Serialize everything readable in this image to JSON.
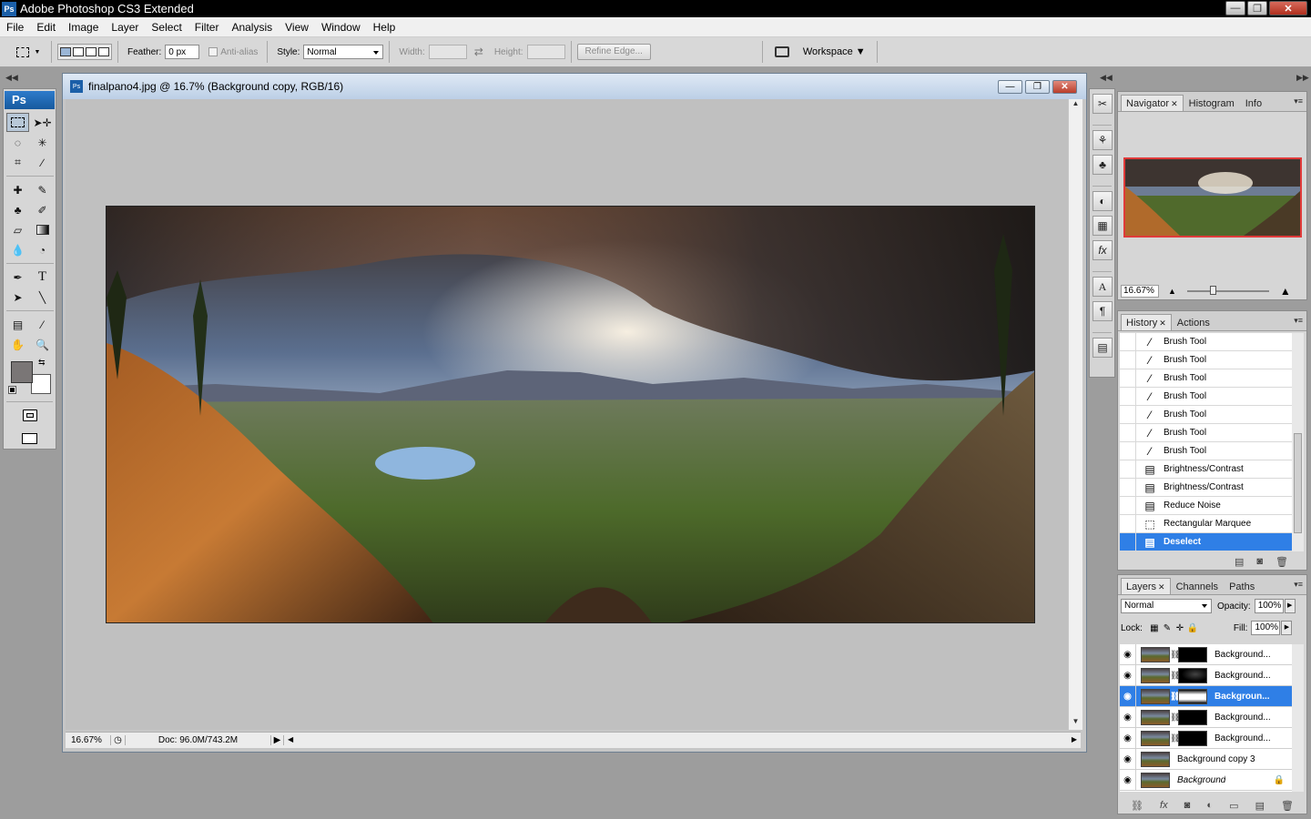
{
  "app": {
    "title": "Adobe Photoshop CS3 Extended",
    "logo": "Ps",
    "window_buttons": [
      "—",
      "❐",
      "✕"
    ]
  },
  "menu": [
    "File",
    "Edit",
    "Image",
    "Layer",
    "Select",
    "Filter",
    "Analysis",
    "View",
    "Window",
    "Help"
  ],
  "options": {
    "feather_label": "Feather:",
    "feather_value": "0 px",
    "antialias_label": "Anti-alias",
    "style_label": "Style:",
    "style_value": "Normal",
    "width_label": "Width:",
    "height_label": "Height:",
    "refine_edge": "Refine Edge...",
    "workspace": "Workspace ▼"
  },
  "toolbox": {
    "logo": "Ps"
  },
  "document": {
    "title": "finalpano4.jpg @ 16.7% (Background copy, RGB/16)",
    "status_zoom": "16.67%",
    "status_doc": "Doc: 96.0M/743.2M"
  },
  "navigator": {
    "tabs": [
      "Navigator",
      "Histogram",
      "Info"
    ],
    "zoom": "16.67%",
    "zoom_fraction": 0.3
  },
  "history": {
    "tabs": [
      "History",
      "Actions"
    ],
    "items": [
      {
        "label": "Brush Tool",
        "icon": "brush-icon"
      },
      {
        "label": "Brush Tool",
        "icon": "brush-icon"
      },
      {
        "label": "Brush Tool",
        "icon": "brush-icon"
      },
      {
        "label": "Brush Tool",
        "icon": "brush-icon"
      },
      {
        "label": "Brush Tool",
        "icon": "brush-icon"
      },
      {
        "label": "Brush Tool",
        "icon": "brush-icon"
      },
      {
        "label": "Brush Tool",
        "icon": "brush-icon"
      },
      {
        "label": "Brightness/Contrast",
        "icon": "adjustment-icon"
      },
      {
        "label": "Brightness/Contrast",
        "icon": "adjustment-icon"
      },
      {
        "label": "Reduce Noise",
        "icon": "adjustment-icon"
      },
      {
        "label": "Rectangular Marquee",
        "icon": "marquee-icon"
      },
      {
        "label": "Deselect",
        "icon": "adjustment-icon",
        "selected": true
      }
    ]
  },
  "layers": {
    "tabs": [
      "Layers",
      "Channels",
      "Paths"
    ],
    "blend_mode": "Normal",
    "opacity_label": "Opacity:",
    "opacity": "100%",
    "lock_label": "Lock:",
    "fill_label": "Fill:",
    "fill": "100%",
    "items": [
      {
        "name": "Background...",
        "mask": true
      },
      {
        "name": "Background...",
        "mask": true
      },
      {
        "name": "Backgroun...",
        "mask": true,
        "selected": true
      },
      {
        "name": "Background...",
        "mask": true
      },
      {
        "name": "Background...",
        "mask": true
      },
      {
        "name": "Background copy 3",
        "mask": false
      },
      {
        "name": "Background",
        "mask": false,
        "locked": true,
        "italic": true
      }
    ]
  },
  "colors": {
    "selection": "#2f7fe6",
    "nav_frame": "#e03a3a"
  }
}
